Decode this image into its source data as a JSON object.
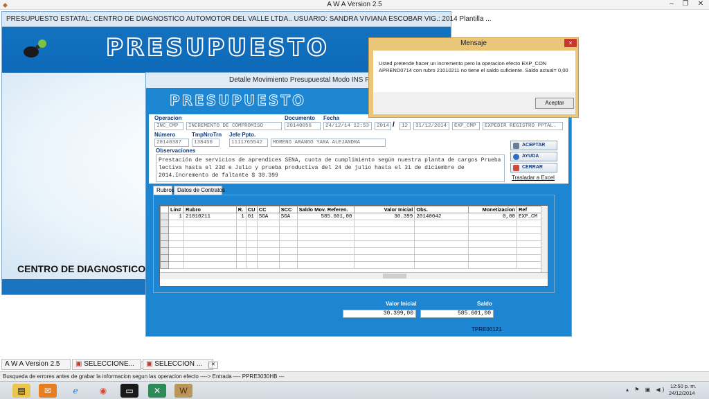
{
  "app": {
    "title": "A W A Version 2.5"
  },
  "main_window": {
    "title": "PRESUPUESTO ESTATAL: CENTRO DE DIAGNOSTICO AUTOMOTOR DEL VALLE LTDA.. USUARIO: SANDRA VIVIANA ESCOBAR VIG.:    2014  Plantilla  ...",
    "banner_logo": "PRESUPUESTO",
    "center_label": "CENTRO DE DIAGNOSTICO ..."
  },
  "detail_window": {
    "title": "Detalle Movimiento Presupuestal Modo INS Forma...",
    "logo": "PRESUPUESTO",
    "labels": {
      "operacion": "Operacion",
      "documento": "Documento",
      "fecha": "Fecha",
      "numero": "Número",
      "tmp_nro_trn": "TmpNroTrn",
      "jefe_ppto": "Jefe Ppto.",
      "observaciones": "Observaciones"
    },
    "fields": {
      "operacion_code": "INC_CMP",
      "operacion_desc": "INCREMENTO DE COMPROMISO",
      "documento": "20140056",
      "fecha": "24/12/14 12:53",
      "year": "2014",
      "slash": "/",
      "month": "12",
      "fecha_fin": "31/12/2014",
      "codigo": "EXP_CMP",
      "codigo_desc": "EXPEDIR REGISTRO PPTAL.",
      "numero": "20140387",
      "tmp_nro_trn": "138450",
      "jefe_id": "1111765542",
      "jefe_nombre": "MORENO ARANGO YARA ALEJANDRA"
    },
    "observaciones": "Prestación de servicios de aprendices SENA, cuota de cumplimiento según nuestra planta de cargos Prueba lectiva hasta el 23d e Julio y prueba productiva del 24 de julio hasta el 31 de diciembre de 2014.Incremento de faltante $ 30.399",
    "buttons": {
      "aceptar": "ACEPTAR",
      "ayuda": "AYUDA",
      "cerrar": "CERRAR",
      "excel": "Trasladar a Excel"
    },
    "tabs": [
      "Rubros",
      "Datos de Contratos"
    ],
    "grid": {
      "headers": [
        "Lin#",
        "Rubro",
        "R.",
        "CU",
        "CC",
        "SCC",
        "Saldo Mov. Referen.",
        "Valor Inicial",
        "Obs.",
        "Monetizacion",
        "Ref"
      ],
      "rows": [
        [
          "1",
          "21010211",
          "1",
          "01",
          "SGA",
          "SGA",
          "585.601,00",
          "30.399",
          "20140042",
          "0,00",
          "EXP_CM"
        ]
      ]
    },
    "totals": {
      "valor_inicial_label": "Valor Inicial",
      "saldo_label": "Saldo",
      "valor_inicial": "30.399,00",
      "saldo": "585.601,00"
    },
    "form_id": "TPRE00121"
  },
  "message_dialog": {
    "title": "Mensaje",
    "close": "×",
    "text": "Usted pretende hacer un incremento pero la operacion efecto EXP_CON APREND0714  con rubro 21010211     no tiene el saldo suficiente. Saldo actual= 0,00",
    "ok": "Aceptar"
  },
  "window_tabs": [
    {
      "label": "A W A Version 2.5"
    },
    {
      "label": "SELECCIONE..."
    },
    {
      "label": "SELECCION ..."
    }
  ],
  "status_bar": "Busqueda de errores antes de grabar la informacion segun las operacion efecto  ---->   Entrada ---- PPRE3030HB  ---",
  "taskbar": {
    "time": "12:50 p. m.",
    "date": "24/12/2014"
  }
}
